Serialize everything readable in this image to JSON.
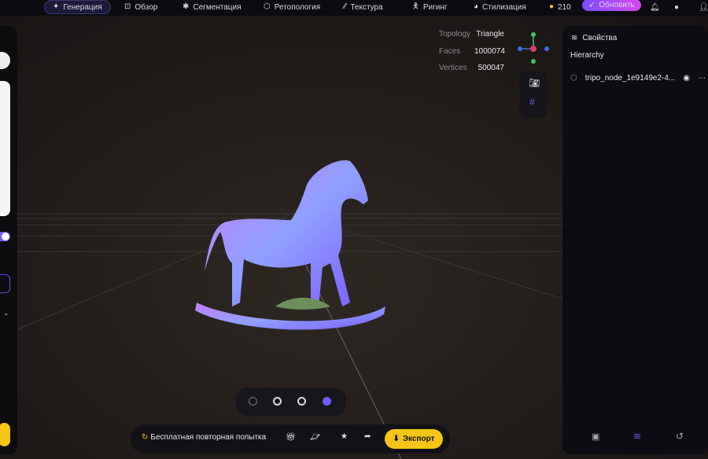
{
  "nav": {
    "items": [
      {
        "label": "Генерация",
        "icon": "sparkle-icon",
        "active": true
      },
      {
        "label": "Обзор",
        "icon": "scan-icon"
      },
      {
        "label": "Сегментация",
        "icon": "puzzle-icon"
      },
      {
        "label": "Ретопология",
        "icon": "mesh-icon"
      },
      {
        "label": "Текстура",
        "icon": "texture-icon"
      },
      {
        "label": "Ригинг",
        "icon": "figure-icon"
      },
      {
        "label": "Стилизация",
        "icon": "palette-icon"
      }
    ],
    "credits": "210",
    "upgrade_label": "Обновить",
    "accent": "#8b5cf6"
  },
  "stats": {
    "topology_label": "Topology",
    "topology": "Triangle",
    "faces_label": "Faces",
    "faces": "1000074",
    "vertices_label": "Vertices",
    "vertices": "500047"
  },
  "properties": {
    "title": "Свойства",
    "hierarchy_label": "Hierarchy",
    "node_name": "tripo_node_1e9149e2-4..."
  },
  "bottom": {
    "retry_label": "Бесплатная повторная попытка",
    "export_label": "Экспорт",
    "export_color": "#f5c518"
  },
  "view_modes": [
    "clay",
    "wireframe",
    "outline",
    "normal"
  ]
}
